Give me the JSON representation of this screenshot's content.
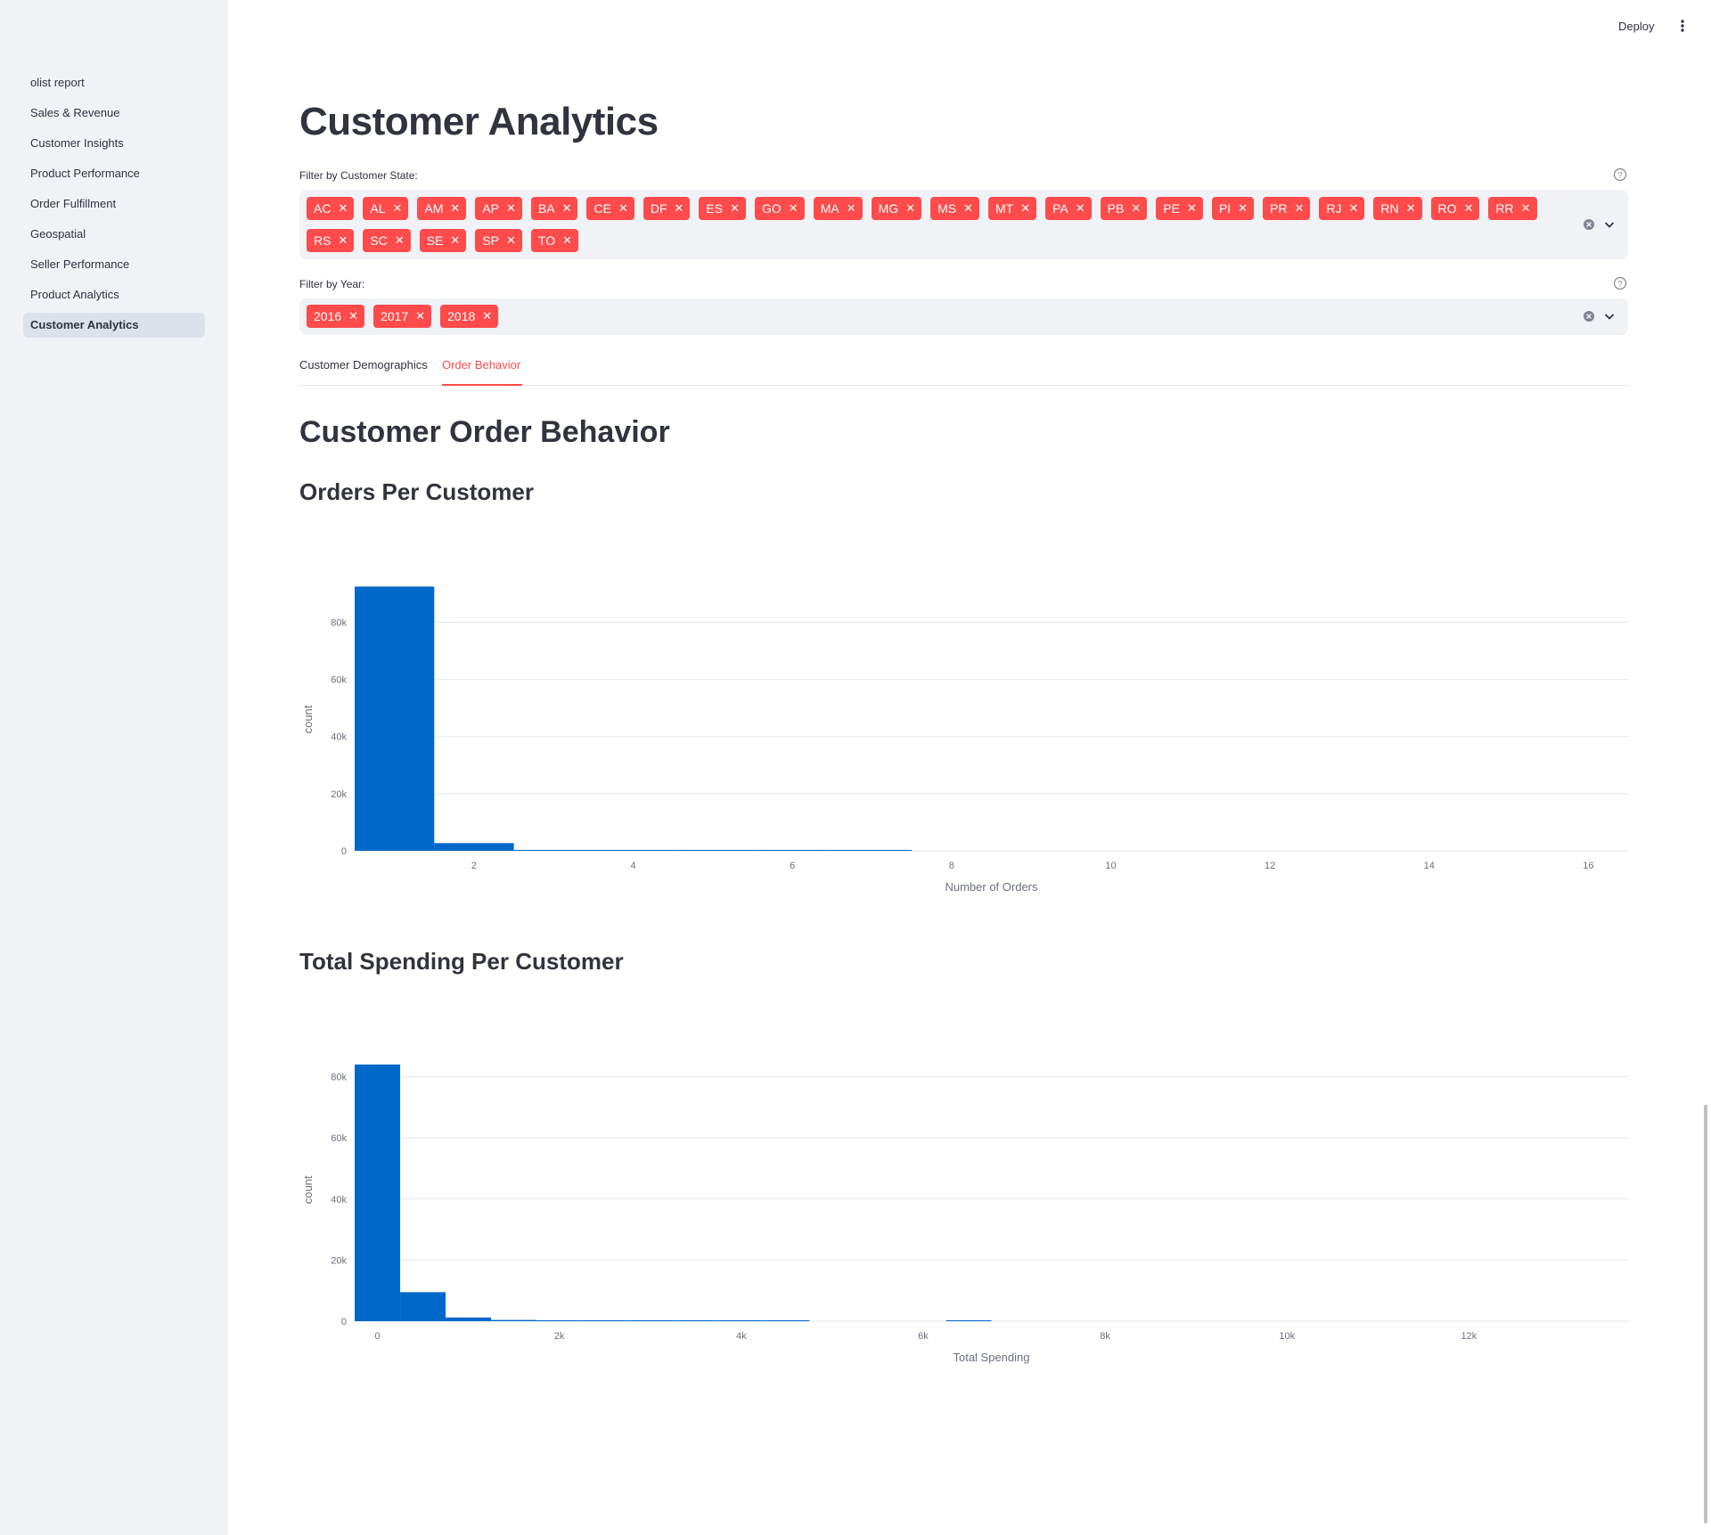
{
  "app": {
    "deploy_label": "Deploy"
  },
  "sidebar": {
    "items": [
      {
        "label": "olist report"
      },
      {
        "label": "Sales & Revenue"
      },
      {
        "label": "Customer Insights"
      },
      {
        "label": "Product Performance"
      },
      {
        "label": "Order Fulfillment"
      },
      {
        "label": "Geospatial"
      },
      {
        "label": "Seller Performance"
      },
      {
        "label": "Product Analytics"
      },
      {
        "label": "Customer Analytics",
        "active": true
      }
    ]
  },
  "page": {
    "title": "Customer Analytics"
  },
  "filters": {
    "state": {
      "label": "Filter by Customer State:",
      "selected": [
        "AC",
        "AL",
        "AM",
        "AP",
        "BA",
        "CE",
        "DF",
        "ES",
        "GO",
        "MA",
        "MG",
        "MS",
        "MT",
        "PA",
        "PB",
        "PE",
        "PI",
        "PR",
        "RJ",
        "RN",
        "RO",
        "RR",
        "RS",
        "SC",
        "SE",
        "SP",
        "TO"
      ]
    },
    "year": {
      "label": "Filter by Year:",
      "selected": [
        "2016",
        "2017",
        "2018"
      ]
    }
  },
  "tabs": [
    {
      "label": "Customer Demographics",
      "active": false
    },
    {
      "label": "Order Behavior",
      "active": true
    }
  ],
  "section": {
    "title": "Customer Order Behavior",
    "chart1_title": "Orders Per Customer",
    "chart2_title": "Total Spending Per Customer"
  },
  "colors": {
    "accent": "#ff4b4b",
    "bar": "#0068c9",
    "sidebar_bg": "#f0f2f6"
  },
  "icons": {
    "help": "help-circle-icon",
    "clear": "clear-circle-icon",
    "chevron": "chevron-down-icon",
    "menu": "kebab-menu-icon"
  },
  "chart_data": [
    {
      "type": "bar",
      "title": "Orders Per Customer",
      "xlabel": "Number of Orders",
      "ylabel": "count",
      "xlim": [
        0.5,
        16.5
      ],
      "ylim": [
        0,
        92000
      ],
      "x_ticks": [
        2,
        4,
        6,
        8,
        10,
        12,
        14,
        16
      ],
      "x_tick_labels": [
        "2",
        "4",
        "6",
        "8",
        "10",
        "12",
        "14",
        "16"
      ],
      "y_ticks": [
        0,
        20000,
        40000,
        60000,
        80000
      ],
      "y_tick_labels": [
        "0",
        "20k",
        "40k",
        "60k",
        "80k"
      ],
      "bins": [
        {
          "x0": 0.5,
          "x1": 1.5,
          "value": 92500
        },
        {
          "x0": 1.5,
          "x1": 2.5,
          "value": 2700
        },
        {
          "x0": 2.5,
          "x1": 3.5,
          "value": 200
        },
        {
          "x0": 3.5,
          "x1": 4.5,
          "value": 30
        },
        {
          "x0": 4.5,
          "x1": 5.5,
          "value": 10
        },
        {
          "x0": 5.5,
          "x1": 6.5,
          "value": 5
        },
        {
          "x0": 6.5,
          "x1": 7.5,
          "value": 3
        }
      ],
      "grid": true
    },
    {
      "type": "bar",
      "title": "Total Spending Per Customer",
      "xlabel": "Total Spending",
      "ylabel": "count",
      "xlim": [
        -250,
        13750
      ],
      "ylim": [
        0,
        86000
      ],
      "x_ticks": [
        0,
        2000,
        4000,
        6000,
        8000,
        10000,
        12000
      ],
      "x_tick_labels": [
        "0",
        "2k",
        "4k",
        "6k",
        "8k",
        "10k",
        "12k"
      ],
      "y_ticks": [
        0,
        20000,
        40000,
        60000,
        80000
      ],
      "y_tick_labels": [
        "0",
        "20k",
        "40k",
        "60k",
        "80k"
      ],
      "bins": [
        {
          "x0": -250,
          "x1": 250,
          "value": 84000
        },
        {
          "x0": 250,
          "x1": 750,
          "value": 9500
        },
        {
          "x0": 750,
          "x1": 1250,
          "value": 1200
        },
        {
          "x0": 1250,
          "x1": 1750,
          "value": 400
        },
        {
          "x0": 1750,
          "x1": 2250,
          "value": 150
        },
        {
          "x0": 2250,
          "x1": 2750,
          "value": 70
        },
        {
          "x0": 2750,
          "x1": 3250,
          "value": 40
        },
        {
          "x0": 3250,
          "x1": 3750,
          "value": 25
        },
        {
          "x0": 3750,
          "x1": 4250,
          "value": 15
        },
        {
          "x0": 4250,
          "x1": 4750,
          "value": 10
        },
        {
          "x0": 6250,
          "x1": 6750,
          "value": 3
        }
      ],
      "grid": true
    }
  ]
}
